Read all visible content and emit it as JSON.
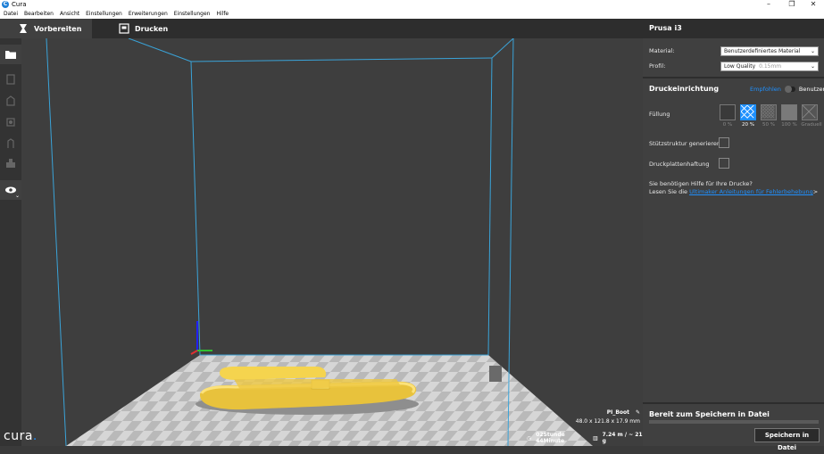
{
  "window": {
    "title": "Cura",
    "app_icon": "C"
  },
  "menu": [
    "Datei",
    "Bearbeiten",
    "Ansicht",
    "Einstellungen",
    "Erweiterungen",
    "Einstellungen",
    "Hilfe"
  ],
  "tabs": {
    "prepare": "Vorbereiten",
    "print": "Drucken"
  },
  "logo": {
    "text": "cura",
    "dot": "."
  },
  "object": {
    "name": "PI_Boot",
    "dimensions": "48.0 x 121.8 x 17.9 mm"
  },
  "print_info": {
    "time": "02Stunde 44Minute",
    "material": "7.24 m / ~ 21 g"
  },
  "sidebar": {
    "printer": "Prusa i3",
    "material_label": "Material:",
    "material_value": "Benutzerdefiniertes Material",
    "profile_label": "Profil:",
    "profile_value": "Low Quality",
    "profile_sub": "0.15mm",
    "setup_title": "Druckeinrichtung",
    "recommended": "Empfohlen",
    "custom": "Benutzerdefiniert",
    "infill_label": "Füllung",
    "infill_options": [
      "0 %",
      "20 %",
      "50 %",
      "100 %",
      "Graduell"
    ],
    "infill_selected": "20 %",
    "support_label": "Stützstruktur generieren",
    "adhesion_label": "Druckplattenhaftung",
    "help_line1": "Sie benötigen Hilfe für Ihre Drucke?",
    "help_line2_pre": "Lesen Sie die ",
    "help_link": "Ultimaker Anleitungen für Fehlerbehebung",
    "help_line2_post": ">"
  },
  "save": {
    "title": "Bereit zum Speichern in Datei",
    "button": "Speichern in Datei"
  },
  "colors": {
    "accent": "#1e90ff",
    "model": "#f7d24a",
    "frame": "#3aa3d8"
  }
}
